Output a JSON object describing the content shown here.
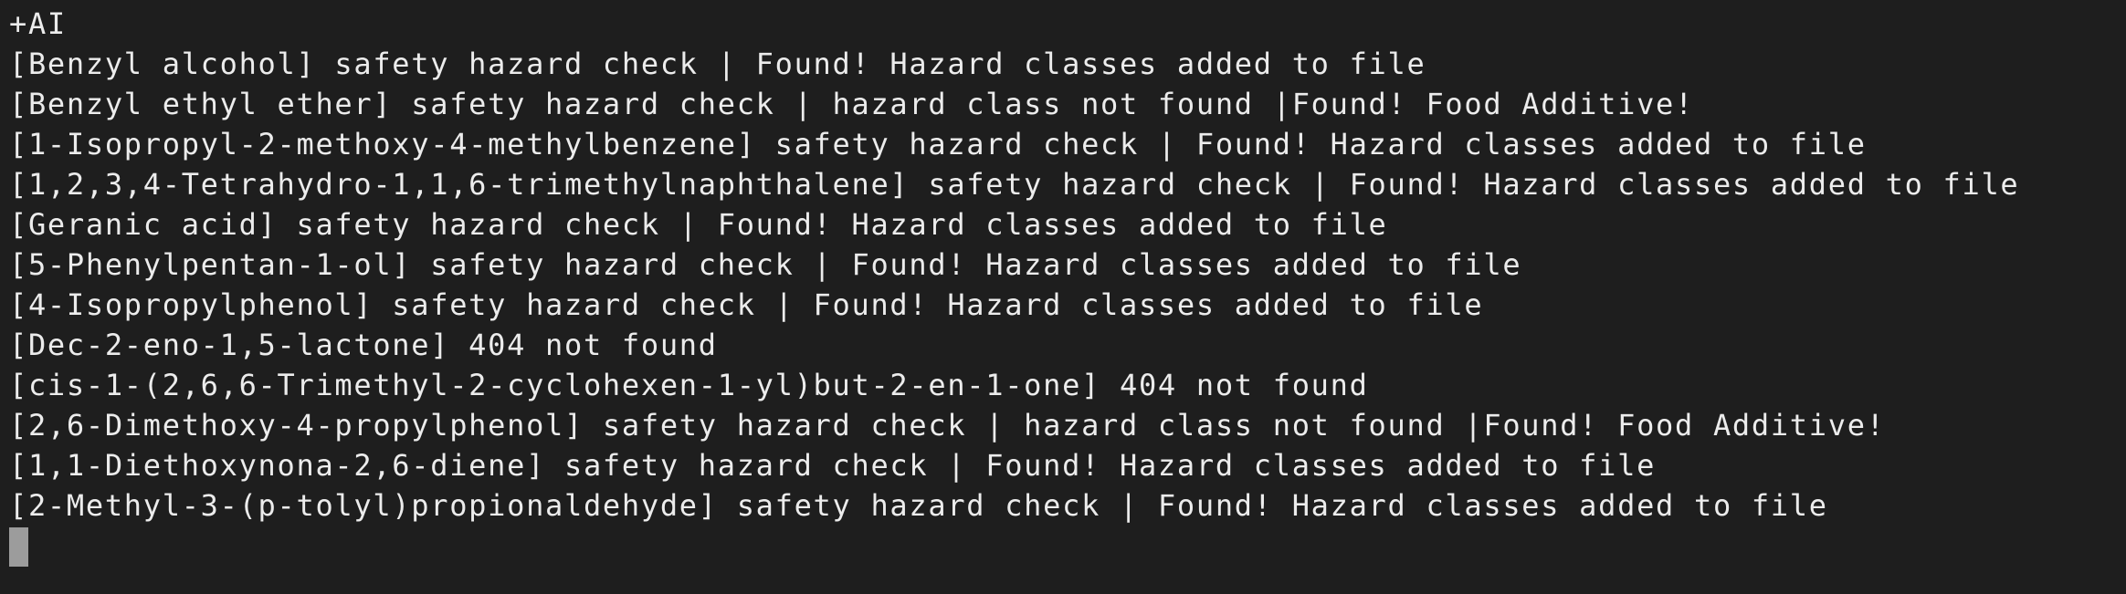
{
  "terminal": {
    "lines": [
      "+AI",
      "[Benzyl alcohol] safety hazard check | Found! Hazard classes added to file",
      "[Benzyl ethyl ether] safety hazard check | hazard class not found |Found! Food Additive!",
      "[1-Isopropyl-2-methoxy-4-methylbenzene] safety hazard check | Found! Hazard classes added to file",
      "[1,2,3,4-Tetrahydro-1,1,6-trimethylnaphthalene] safety hazard check | Found! Hazard classes added to file",
      "[Geranic acid] safety hazard check | Found! Hazard classes added to file",
      "[5-Phenylpentan-1-ol] safety hazard check | Found! Hazard classes added to file",
      "[4-Isopropylphenol] safety hazard check | Found! Hazard classes added to file",
      "[Dec-2-eno-1,5-lactone] 404 not found",
      "[cis-1-(2,6,6-Trimethyl-2-cyclohexen-1-yl)but-2-en-1-one] 404 not found",
      "[2,6-Dimethoxy-4-propylphenol] safety hazard check | hazard class not found |Found! Food Additive!",
      "[1,1-Diethoxynona-2,6-diene] safety hazard check | Found! Hazard classes added to file",
      "[2-Methyl-3-(p-tolyl)propionaldehyde] safety hazard check | Found! Hazard classes added to file"
    ],
    "colors": {
      "background": "#1e1e1e",
      "text": "#ececec",
      "cursor": "#9c9c9c"
    }
  }
}
